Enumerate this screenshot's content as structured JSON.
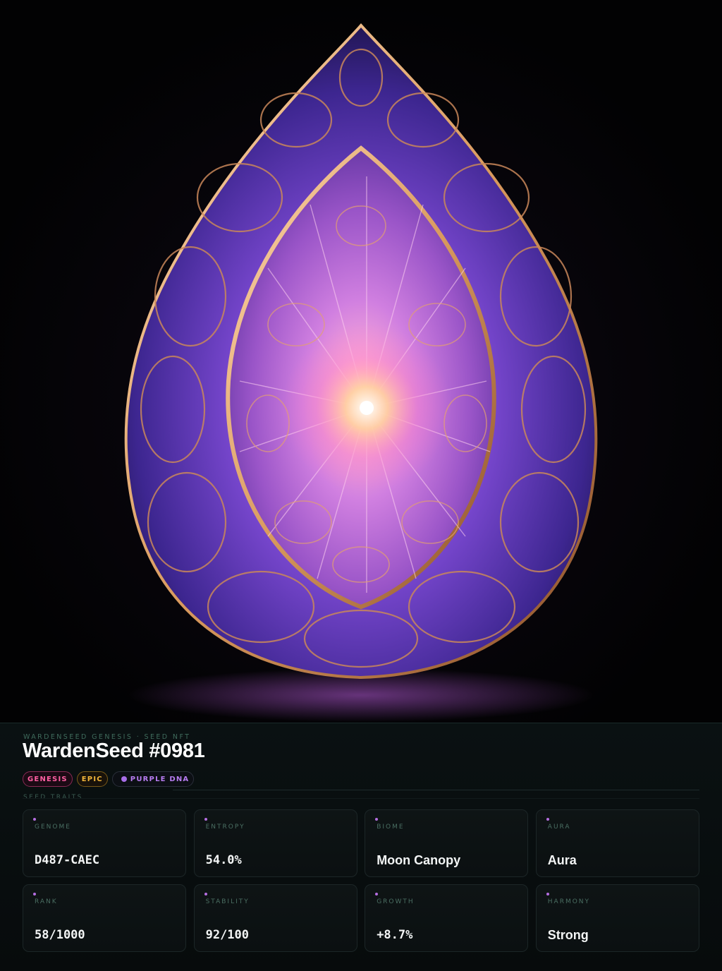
{
  "hero": {
    "image_description_icon": "crystal-seed-icon"
  },
  "header": {
    "kicker": "WARDENSEED GENESIS · SEED NFT",
    "title": "WardenSeed #0981"
  },
  "badges": [
    {
      "label": "GENESIS",
      "color": "#ff5fa2"
    },
    {
      "label": "EPIC",
      "color": "#f2b53a"
    },
    {
      "label": "PURPLE DNA",
      "color": "#b77cf0"
    }
  ],
  "traits": {
    "section_label": "SEED TRAITS",
    "items": [
      {
        "label": "GENOME",
        "value": "D487-CAEC"
      },
      {
        "label": "ENTROPY",
        "value": "54.0%"
      },
      {
        "label": "BIOME",
        "value": "Moon Canopy"
      },
      {
        "label": "AURA",
        "value": "Aura"
      },
      {
        "label": "RANK",
        "value": "58/1000"
      },
      {
        "label": "STABILITY",
        "value": "92/100"
      },
      {
        "label": "GROWTH",
        "value": "+8.7%"
      },
      {
        "label": "HARMONY",
        "value": "Strong"
      }
    ]
  },
  "colors": {
    "accent": "#b56ee0",
    "background": "#050708",
    "gold": "#d99a5e"
  }
}
